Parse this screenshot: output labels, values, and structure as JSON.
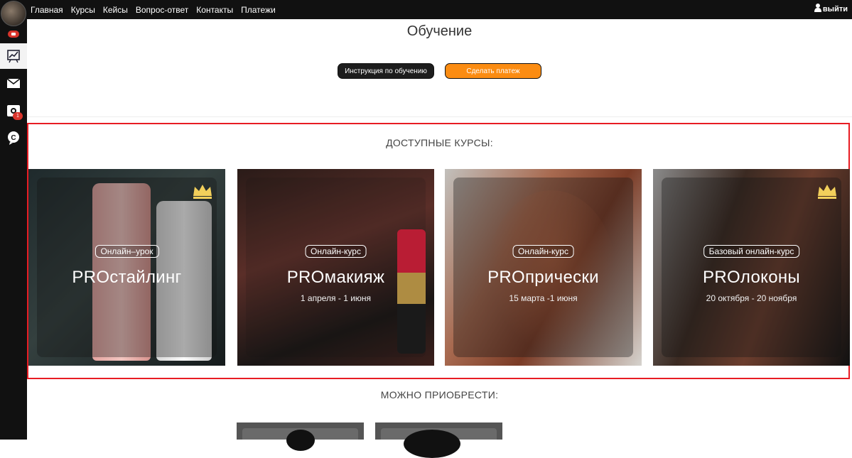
{
  "nav": {
    "items": [
      "Главная",
      "Курсы",
      "Кейсы",
      "Вопрос-ответ",
      "Контакты",
      "Платежи"
    ],
    "logout_label": "выйти"
  },
  "rail": {
    "notification_count": "1"
  },
  "page": {
    "title": "Обучение",
    "instruction_button": "Инструкция по обучению",
    "pay_button": "Сделать платеж"
  },
  "sections": {
    "available": "ДОСТУПНЫЕ КУРСЫ:",
    "purchasable": "МОЖНО ПРИОБРЕСТИ:"
  },
  "courses": [
    {
      "tag": "Онлайн–урок",
      "name": "PROстайлинг",
      "dates": "",
      "crown": true
    },
    {
      "tag": "Онлайн-курс",
      "name": "PROмакияж",
      "dates": "1 апреля - 1 июня",
      "crown": false
    },
    {
      "tag": "Онлайн-курс",
      "name": "PROприческi",
      "dates": "15 марта -1 июня",
      "crown": false
    },
    {
      "tag": "Базовый онлайн-курс",
      "name": "PROлоконы",
      "dates": "20 октября - 20 ноября",
      "crown": true
    }
  ],
  "colors": {
    "accent": "#fb8c12",
    "frame": "#e81c23",
    "crown": "#f2cf5b"
  }
}
